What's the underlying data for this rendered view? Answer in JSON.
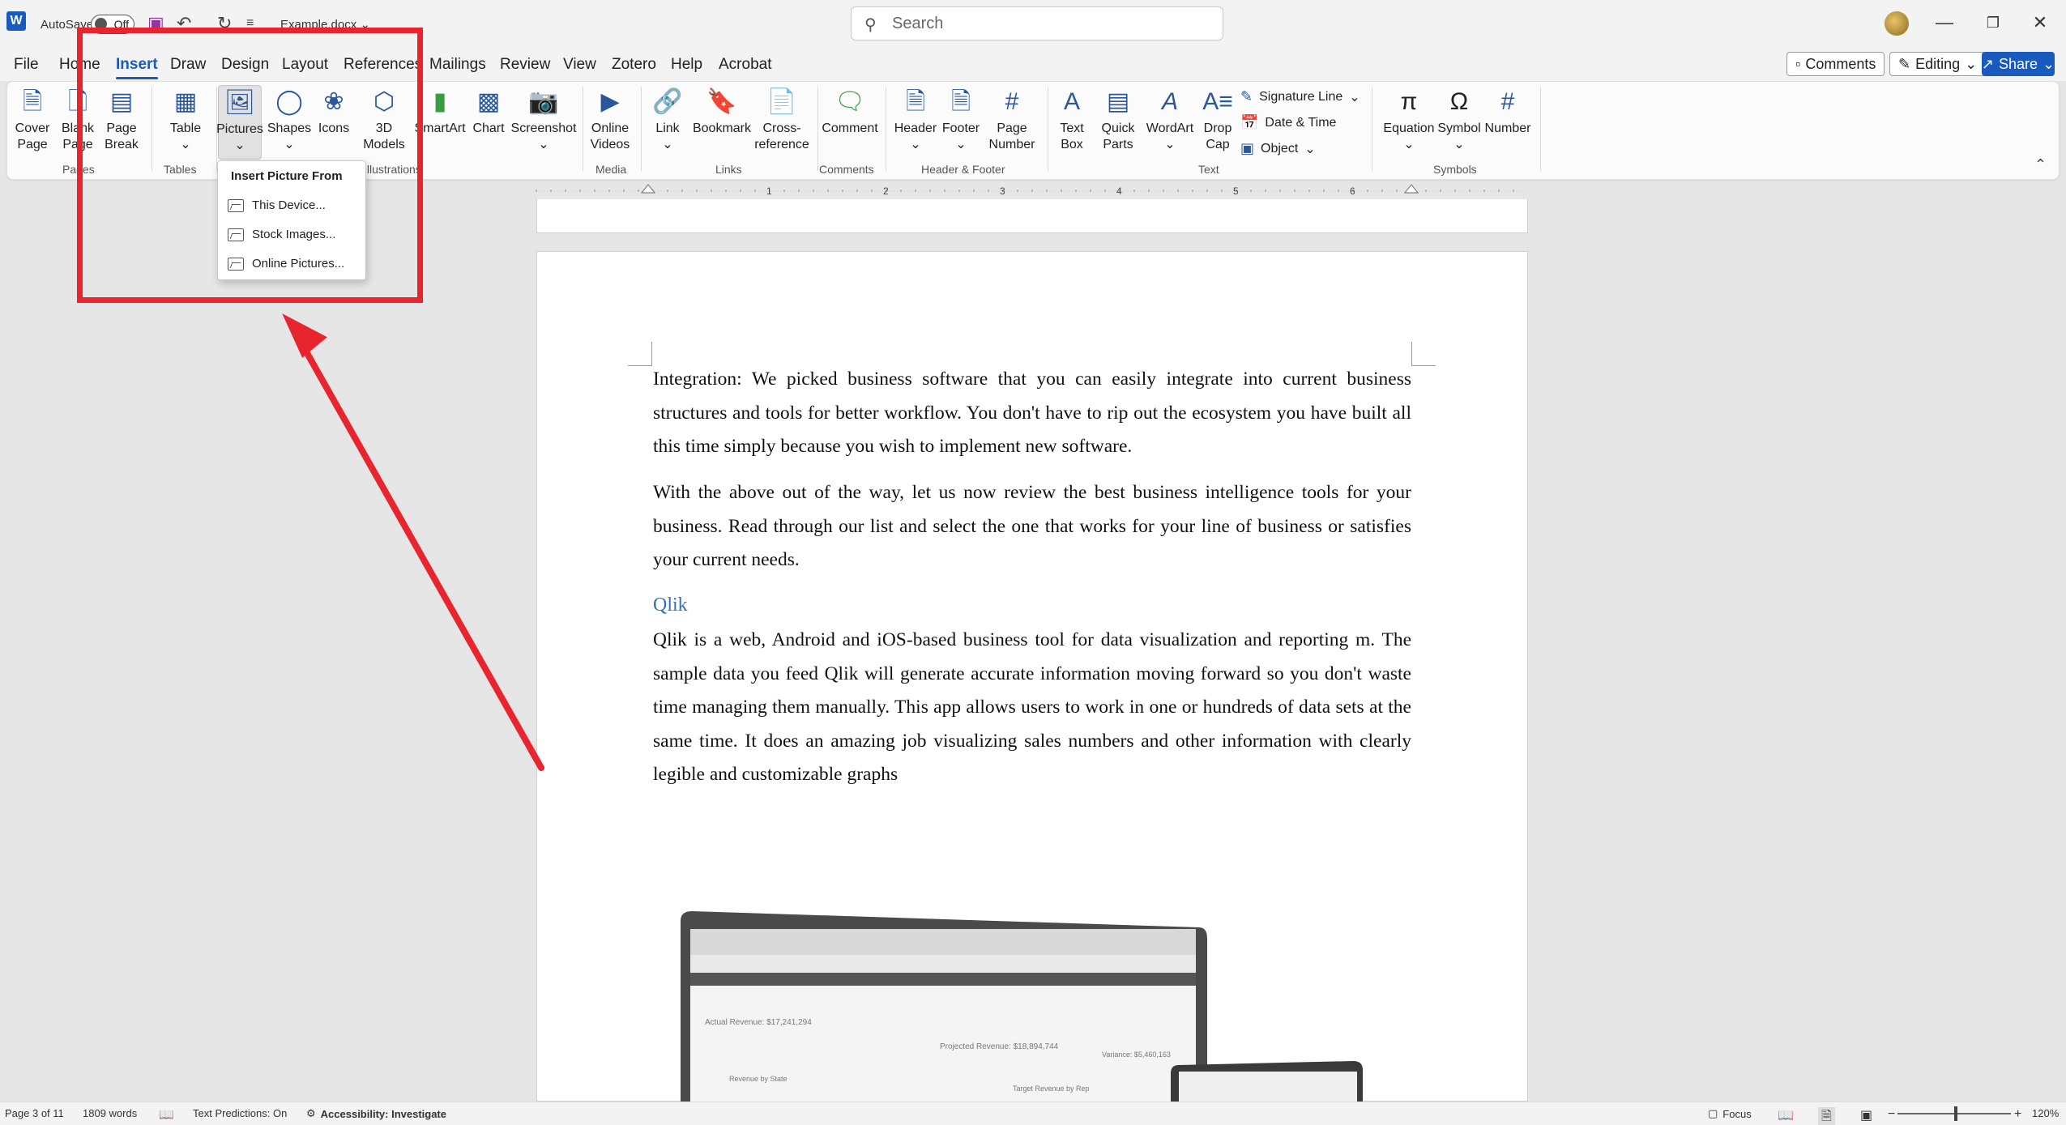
{
  "titlebar": {
    "autosave_label": "AutoSave",
    "autosave_state": "Off",
    "doc_name": "Example.docx",
    "search_placeholder": "Search"
  },
  "tabs": [
    "File",
    "Home",
    "Insert",
    "Draw",
    "Design",
    "Layout",
    "References",
    "Mailings",
    "Review",
    "View",
    "Zotero",
    "Help",
    "Acrobat"
  ],
  "active_tab": "Insert",
  "header_buttons": {
    "comments": "Comments",
    "editing": "Editing",
    "share": "Share"
  },
  "ribbon": {
    "cover_page": [
      "Cover",
      "Page"
    ],
    "blank_page": [
      "Blank",
      "Page"
    ],
    "page_break": [
      "Page",
      "Break"
    ],
    "table": "Table",
    "pictures": "Pictures",
    "shapes": "Shapes",
    "icons": "Icons",
    "models_3d": [
      "3D",
      "Models"
    ],
    "smartart": "SmartArt",
    "chart": "Chart",
    "screenshot": "Screenshot",
    "online_videos": [
      "Online",
      "Videos"
    ],
    "link": "Link",
    "bookmark": "Bookmark",
    "cross_reference": [
      "Cross-",
      "reference"
    ],
    "comment": "Comment",
    "header": "Header",
    "footer": "Footer",
    "page_number": [
      "Page",
      "Number"
    ],
    "text_box": [
      "Text",
      "Box"
    ],
    "quick_parts": [
      "Quick",
      "Parts"
    ],
    "wordart": "WordArt",
    "drop_cap": [
      "Drop",
      "Cap"
    ],
    "signature_line": "Signature Line",
    "date_time": "Date & Time",
    "object": "Object",
    "equation": "Equation",
    "symbol": "Symbol",
    "number": "Number",
    "groups": {
      "pages": "Pages",
      "tables": "Tables",
      "illustrations": "Illustrations",
      "media": "Media",
      "links": "Links",
      "comments": "Comments",
      "header_footer": "Header & Footer",
      "text": "Text",
      "symbols": "Symbols"
    }
  },
  "ruler_numbers": [
    "1",
    "2",
    "3",
    "4",
    "5",
    "6"
  ],
  "dropdown": {
    "title": "Insert Picture From",
    "items": [
      "This Device...",
      "Stock Images...",
      "Online Pictures..."
    ]
  },
  "document": {
    "para1": "Integration: We picked business software that you can easily integrate into current business structures and tools for better workflow. You don't have to rip out the ecosystem you have built all this time simply because you wish to implement new software.",
    "para2": "With the above out of the way, let us now review the best business intelligence tools for your business. Read through our list and select the one that works for your line of business or satisfies your current needs.",
    "heading": "Qlik",
    "para3": "Qlik is a web, Android and iOS-based business tool for data visualization and reporting m. The sample data you feed Qlik will generate accurate information moving forward so you don't waste time managing them manually.  This app allows users to work in one or hundreds of data sets at the same time. It does an amazing job visualizing sales numbers and other information with clearly legible and customizable graphs"
  },
  "laptop_image": {
    "actual_revenue": "Actual Revenue: $17,241,294",
    "projected_revenue": "Projected Revenue: $18,894,744",
    "variance": "Variance: $5,460,163",
    "revenue_by_state": "Revenue by State",
    "target_revenue": "Target Revenue by Rep"
  },
  "statusbar": {
    "page": "Page 3 of 11",
    "words": "1809 words",
    "text_predictions": "Text Predictions: On",
    "accessibility": "Accessibility: Investigate",
    "focus": "Focus",
    "zoom": "120%"
  },
  "colors": {
    "accent": "#185abd",
    "highlight": "#e8242f",
    "heading": "#2e74b5"
  }
}
